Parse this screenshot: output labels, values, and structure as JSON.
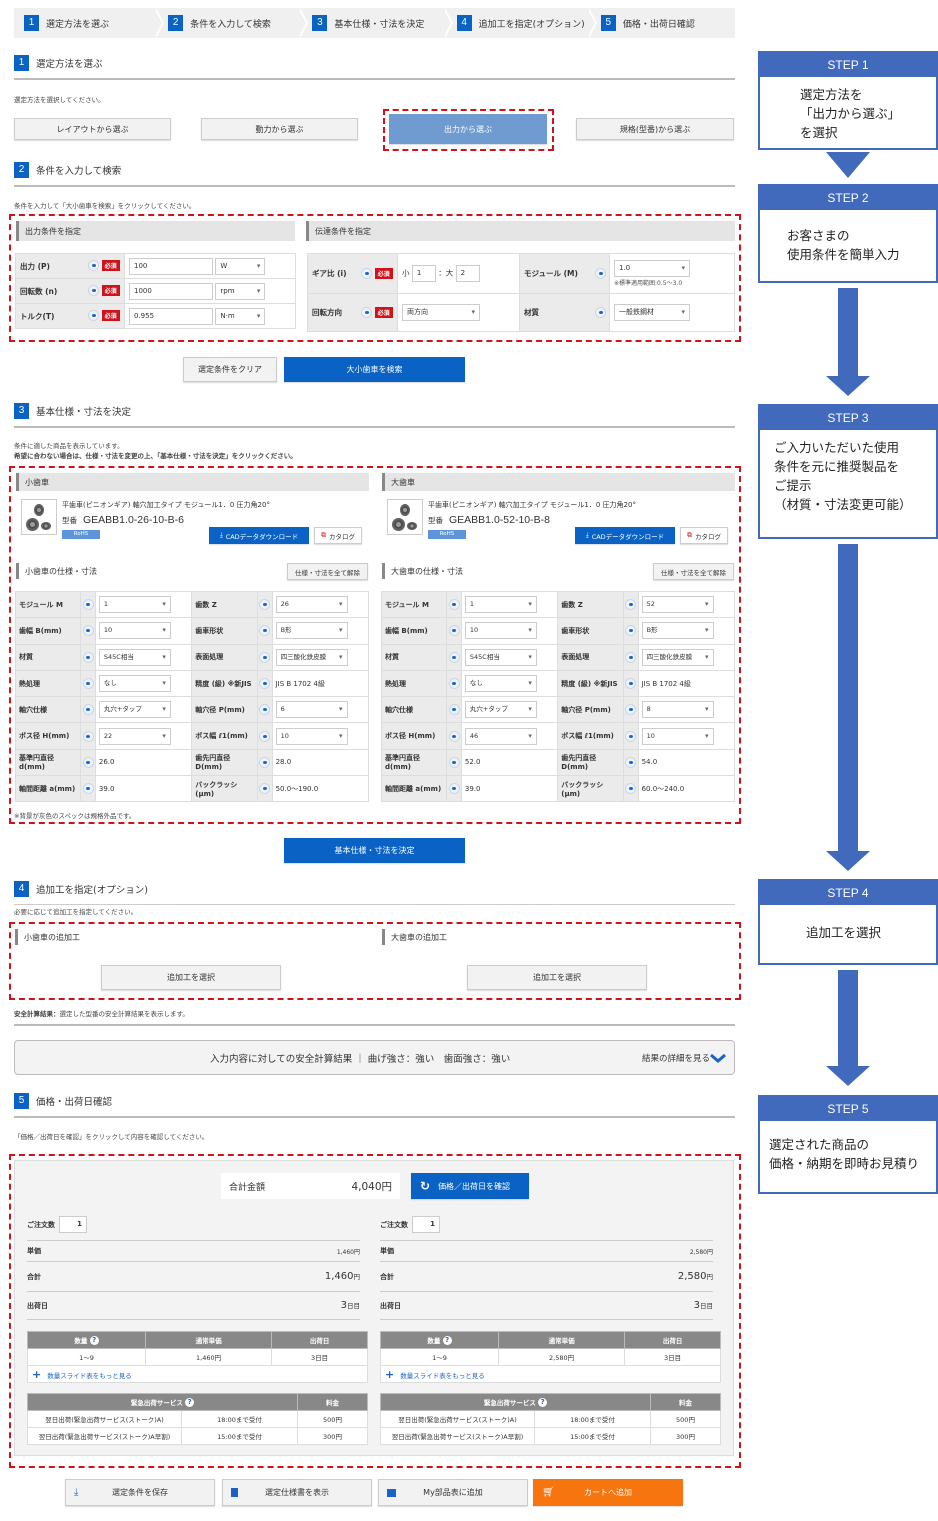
{
  "progress": [
    "選定方法を選ぶ",
    "条件を入力して検索",
    "基本仕様・寸法を決定",
    "追加工を指定(オプション)",
    "価格・出荷日確認"
  ],
  "section1": {
    "num": "1",
    "title": "選定方法を選ぶ",
    "note": "選定方法を選択してください。",
    "buttons": [
      "レイアウトから選ぶ",
      "動力から選ぶ",
      "出力から選ぶ",
      "規格(型番)から選ぶ"
    ],
    "selected": "出力から選ぶ"
  },
  "section2": {
    "num": "2",
    "title": "条件を入力して検索",
    "note": "条件を入力して「大小歯車を検索」をクリックしてください。",
    "output_panel": {
      "title": "出力条件を指定",
      "rows": [
        {
          "label": "出力 (P)",
          "required": "必須",
          "value": "100",
          "unit": "W"
        },
        {
          "label": "回転数 (n)",
          "required": "必須",
          "value": "1000",
          "unit": "rpm"
        },
        {
          "label": "トルク(T)",
          "required": "必須",
          "value": "0.955",
          "unit": "N·m"
        }
      ]
    },
    "transmission_panel": {
      "title": "伝達条件を指定",
      "gear_ratio": {
        "label": "ギア比 (i)",
        "required": "必須",
        "small_label": "小",
        "small": "1",
        "large_label": "：大",
        "large": "2"
      },
      "module": {
        "label": "モジュール (M)",
        "value": "1.0",
        "note": "※標準適用範囲:0.5〜3.0"
      },
      "rotation": {
        "label": "回転方向",
        "required": "必須",
        "value": "両方向"
      },
      "material": {
        "label": "材質",
        "value": "一般鉄鋼材"
      }
    },
    "clear_button": "選定条件をクリア",
    "search_button": "大小歯車を検索"
  },
  "section3": {
    "num": "3",
    "title": "基本仕様・寸法を決定",
    "note1": "条件に適した商品を表示しています。",
    "note2": "希望に合わない場合は、仕様・寸法を変更の上、「基本仕様・寸法を決定」をクリックください。",
    "footnote": "※背景が灰色のスペックは規格外品です。",
    "decide_button": "基本仕様・寸法を決定",
    "gears": [
      {
        "panel": "小歯車",
        "desc": "平歯車(ピニオンギア) 軸穴加工タイプ モジュール1．0 圧力角20°",
        "part_label": "型番",
        "part": "GEABB1.0-26-10-B-6",
        "rohs": "RoHS",
        "cad": "CADデータダウンロード",
        "catalog": "カタログ",
        "spec_title": "小歯車の仕様・寸法",
        "clear_all": "仕様・寸法を全て解除",
        "specs": [
          [
            "モジュール M",
            "1",
            true,
            "歯数 Z",
            "26",
            true
          ],
          [
            "歯幅 B(mm)",
            "10",
            true,
            "歯車形状",
            "B形",
            true
          ],
          [
            "材質",
            "S45C相当",
            true,
            "表面処理",
            "四三酸化鉄皮膜",
            true
          ],
          [
            "熱処理",
            "なし",
            true,
            "精度 (級) ※新JIS",
            "JIS B 1702 4級",
            false
          ],
          [
            "軸穴仕様",
            "丸穴+タップ",
            true,
            "軸穴径 P(mm)",
            "6",
            true
          ],
          [
            "ボス径 H(mm)",
            "22",
            true,
            "ボス幅 ℓ1(mm)",
            "10",
            true
          ],
          [
            "基準円直径 d(mm)",
            "26.0",
            false,
            "歯先円直径 D(mm)",
            "28.0",
            false
          ],
          [
            "軸間距離 a(mm)",
            "39.0",
            false,
            "バックラッシ (μm)",
            "50.0〜190.0",
            false
          ]
        ]
      },
      {
        "panel": "大歯車",
        "desc": "平歯車(ピニオンギア) 軸穴加工タイプ モジュール1．0 圧力角20°",
        "part_label": "型番",
        "part": "GEABB1.0-52-10-B-8",
        "rohs": "RoHS",
        "cad": "CADデータダウンロード",
        "catalog": "カタログ",
        "spec_title": "大歯車の仕様・寸法",
        "clear_all": "仕様・寸法を全て解除",
        "specs": [
          [
            "モジュール M",
            "1",
            true,
            "歯数 Z",
            "52",
            true
          ],
          [
            "歯幅 B(mm)",
            "10",
            true,
            "歯車形状",
            "B形",
            true
          ],
          [
            "材質",
            "S45C相当",
            true,
            "表面処理",
            "四三酸化鉄皮膜",
            true
          ],
          [
            "熱処理",
            "なし",
            true,
            "精度 (級) ※新JIS",
            "JIS B 1702 4級",
            false
          ],
          [
            "軸穴仕様",
            "丸穴+タップ",
            true,
            "軸穴径 P(mm)",
            "8",
            true
          ],
          [
            "ボス径 H(mm)",
            "46",
            true,
            "ボス幅 ℓ1(mm)",
            "10",
            true
          ],
          [
            "基準円直径 d(mm)",
            "52.0",
            false,
            "歯先円直径 D(mm)",
            "54.0",
            false
          ],
          [
            "軸間距離 a(mm)",
            "39.0",
            false,
            "バックラッシ (μm)",
            "60.0〜240.0",
            false
          ]
        ]
      }
    ]
  },
  "section4": {
    "num": "4",
    "title": "追加工を指定(オプション)",
    "note": "必要に応じて追加工を指定してください。",
    "small": "小歯車の追加工",
    "large": "大歯車の追加工",
    "select_button": "追加工を選択"
  },
  "safety": {
    "note_bold": "安全計算結果：",
    "note": "選定した型番の安全計算結果を表示します。",
    "result": "入力内容に対しての安全計算結果 ｜ 曲げ強さ：強い　歯面強さ：強い",
    "details": "結果の詳細を見る"
  },
  "section5": {
    "num": "5",
    "title": "価格・出荷日確認",
    "note": "「価格／出荷日を確認」をクリックして内容を確認してください。",
    "total_label": "合計金額",
    "total": "4,040円",
    "confirm_button": "価格／出荷日を確認",
    "columns": [
      {
        "qty_label": "ご注文数",
        "qty": "1",
        "unit_label": "単価",
        "unit": "1,460円",
        "sum_label": "合計",
        "sum": "1,460",
        "yen": "円",
        "ship_label": "出荷日",
        "ship": "3",
        "ship_unit": "日目",
        "tier_headers": [
          "数量",
          "通常単価",
          "出荷日"
        ],
        "tier": [
          "1〜9",
          "1,460円",
          "3日目"
        ],
        "more": "数量スライド表をもっと見る",
        "express_headers": [
          "緊急出荷サービス",
          "料金"
        ],
        "express": [
          [
            "翌日出荷(緊急出荷サービス(ストーク)A)",
            "18:00まで受付",
            "500円"
          ],
          [
            "翌日出荷(緊急出荷サービス(ストーク)A早割)",
            "15:00まで受付",
            "300円"
          ]
        ]
      },
      {
        "qty_label": "ご注文数",
        "qty": "1",
        "unit_label": "単価",
        "unit": "2,580円",
        "sum_label": "合計",
        "sum": "2,580",
        "yen": "円",
        "ship_label": "出荷日",
        "ship": "3",
        "ship_unit": "日目",
        "tier_headers": [
          "数量",
          "通常単価",
          "出荷日"
        ],
        "tier": [
          "1〜9",
          "2,580円",
          "3日目"
        ],
        "more": "数量スライド表をもっと見る",
        "express_headers": [
          "緊急出荷サービス",
          "料金"
        ],
        "express": [
          [
            "翌日出荷(緊急出荷サービス(ストーク)A)",
            "18:00まで受付",
            "500円"
          ],
          [
            "翌日出荷(緊急出荷サービス(ストーク)A早割)",
            "15:00まで受付",
            "300円"
          ]
        ]
      }
    ]
  },
  "footer_buttons": [
    "選定条件を保存",
    "選定仕様書を表示",
    "My部品表に追加",
    "カートへ追加"
  ],
  "flow": [
    {
      "head": "STEP 1",
      "body": "選定方法を\n「出力から選ぶ」\nを選択"
    },
    {
      "head": "STEP 2",
      "body": "お客さまの\n使用条件を簡単入力"
    },
    {
      "head": "STEP 3",
      "body": "ご入力いただいた使用\n条件を元に推奨製品を\nご提示\n（材質・寸法変更可能）"
    },
    {
      "head": "STEP 4",
      "body": "追加工を選択"
    },
    {
      "head": "STEP 5",
      "body": "選定された商品の\n価格・納期を即時お見積り"
    }
  ],
  "colors": {
    "primary": "#0a62c4",
    "selected": "#6f9bd1",
    "highlight": "#d0121b",
    "cart": "#f7750f",
    "flow": "#4169bc"
  }
}
